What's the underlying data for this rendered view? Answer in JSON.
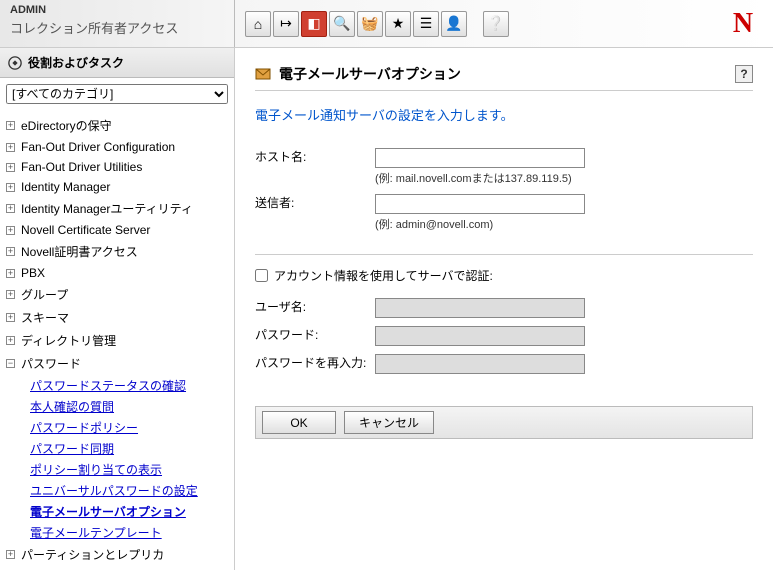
{
  "header": {
    "admin": "ADMIN",
    "subtitle": "コレクション所有者アクセス",
    "logo": "N",
    "toolbar": [
      "home",
      "exit",
      "flag",
      "search",
      "basket",
      "star",
      "list",
      "user",
      "help"
    ]
  },
  "sidebar": {
    "title": "役割およびタスク",
    "category_selected": "[すべてのカテゴリ]",
    "items": [
      {
        "label": "eDirectoryの保守",
        "expanded": false
      },
      {
        "label": "Fan-Out Driver Configuration",
        "expanded": false
      },
      {
        "label": "Fan-Out Driver Utilities",
        "expanded": false
      },
      {
        "label": "Identity Manager",
        "expanded": false
      },
      {
        "label": "Identity Managerユーティリティ",
        "expanded": false
      },
      {
        "label": "Novell Certificate Server",
        "expanded": false
      },
      {
        "label": "Novell証明書アクセス",
        "expanded": false
      },
      {
        "label": "PBX",
        "expanded": false
      },
      {
        "label": "グループ",
        "expanded": false
      },
      {
        "label": "スキーマ",
        "expanded": false
      },
      {
        "label": "ディレクトリ管理",
        "expanded": false
      },
      {
        "label": "パスワード",
        "expanded": true,
        "children": [
          {
            "label": "パスワードステータスの確認"
          },
          {
            "label": "本人確認の質問"
          },
          {
            "label": "パスワードポリシー"
          },
          {
            "label": "パスワード同期"
          },
          {
            "label": "ポリシー割り当ての表示"
          },
          {
            "label": "ユニバーサルパスワードの設定"
          },
          {
            "label": "電子メールサーバオプション",
            "active": true
          },
          {
            "label": "電子メールテンプレート"
          }
        ]
      },
      {
        "label": "パーティションとレプリカ",
        "expanded": false
      }
    ]
  },
  "main": {
    "title": "電子メールサーバオプション",
    "intro": "電子メール通知サーバの設定を入力します。",
    "host_label": "ホスト名:",
    "host_value": "",
    "host_hint": "(例: mail.novell.comまたは137.89.119.5)",
    "from_label": "送信者:",
    "from_value": "",
    "from_hint": "(例: admin@novell.com)",
    "auth_label": "アカウント情報を使用してサーバで認証:",
    "auth_checked": false,
    "user_label": "ユーザ名:",
    "user_value": "",
    "pw_label": "パスワード:",
    "pw_value": "",
    "pw2_label": "パスワードを再入力:",
    "pw2_value": "",
    "ok": "OK",
    "cancel": "キャンセル",
    "help": "?"
  }
}
